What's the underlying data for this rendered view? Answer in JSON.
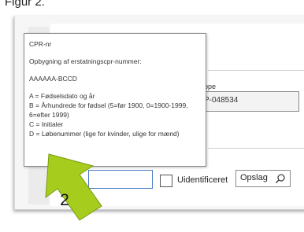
{
  "figure": {
    "title": "Figur 2."
  },
  "form": {
    "field_label_fragment": "ppe",
    "field_value_fragment": "P-048534",
    "checkbox_label": "Uidentificeret",
    "lookup_button_label": "Opslag",
    "lookup_icon": "search-icon",
    "cpr_input_value": ""
  },
  "tooltip": {
    "title": "CPR-nr",
    "heading": "Opbygning af erstatningscpr-nummer:",
    "format": "AAAAAA-BCCD",
    "lines": [
      "A = Fødselsdato og år",
      "B = Århundrede for fødsel (5=før 1900, 0=1900-1999, 6=efter 1999)",
      "C = Initialer",
      "D = Løbenummer (lige for kvinder, ulige for mænd)"
    ]
  },
  "callout": {
    "number": "2",
    "color": "#a6cd1e"
  }
}
